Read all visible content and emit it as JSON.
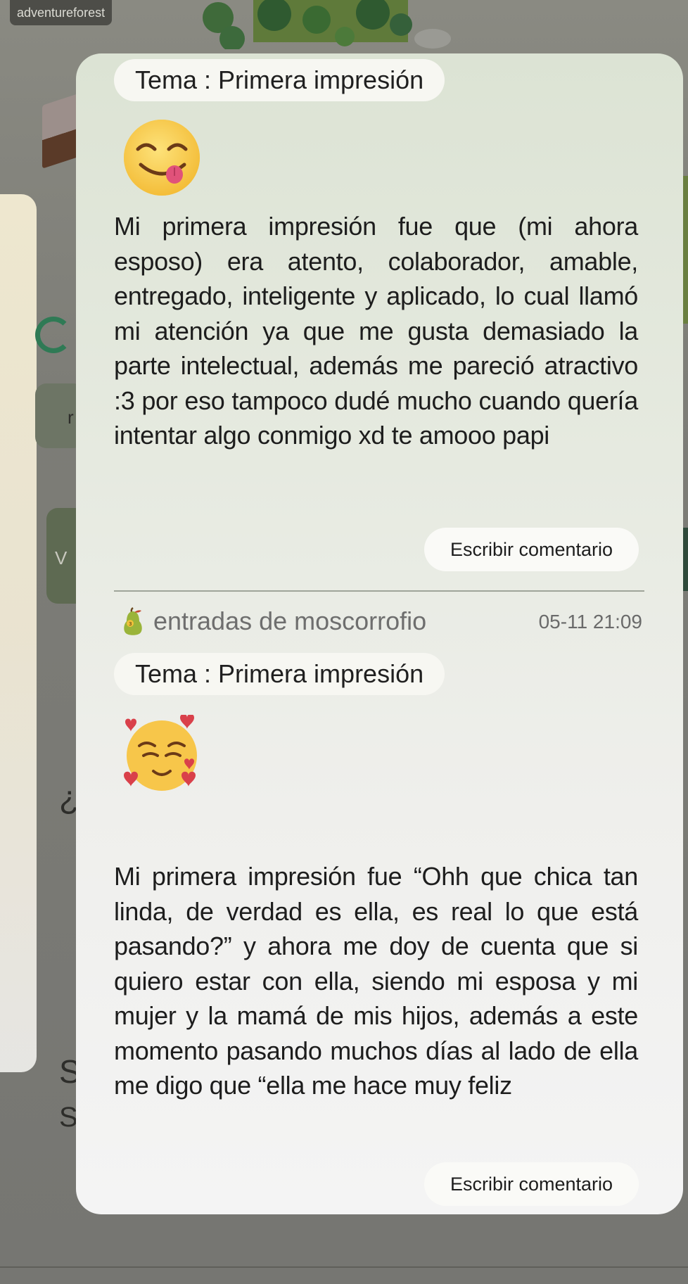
{
  "background": {
    "app_label": "adventureforest",
    "glyph_r": "r",
    "glyph_v": "V",
    "glyph_q": "¿",
    "glyph_s1": "S",
    "glyph_s2": "S"
  },
  "entries": [
    {
      "topic": "Tema : Primera impresión",
      "emoji": "yum-face-icon",
      "text": "Mi primera impresión fue que (mi ahora esposo) era atento, colaborador, amable, entregado, inteligente y aplicado, lo cual llamó mi atención ya que me gusta demasiado la parte intelectual, además me pareció atractivo :3 por eso tampoco dudé mucho cuando quería intentar algo conmigo xd te amooo papi",
      "comment_label": "Escribir comentario"
    },
    {
      "author": "entradas de moscorrofio",
      "date": "05-11 21:09",
      "topic": "Tema : Primera impresión",
      "emoji": "smiling-face-with-hearts-icon",
      "text": "Mi primera impresión fue “Ohh que chica tan linda, de verdad es ella, es real lo que está pasando?” y ahora me doy de cuenta que si quiero estar con ella, siendo mi esposa y mi mujer y la mamá de mis hijos, además a este momento pasando muchos días al lado de ella me digo que “ella me hace muy feliz",
      "comment_label": "Escribir comentario"
    }
  ],
  "colors": {
    "modal_top": "#dce3d4",
    "modal_bottom": "#f4f4f4",
    "chip": "#f7f7f2",
    "text": "#1d1d1d",
    "muted": "#6e6e6e"
  }
}
